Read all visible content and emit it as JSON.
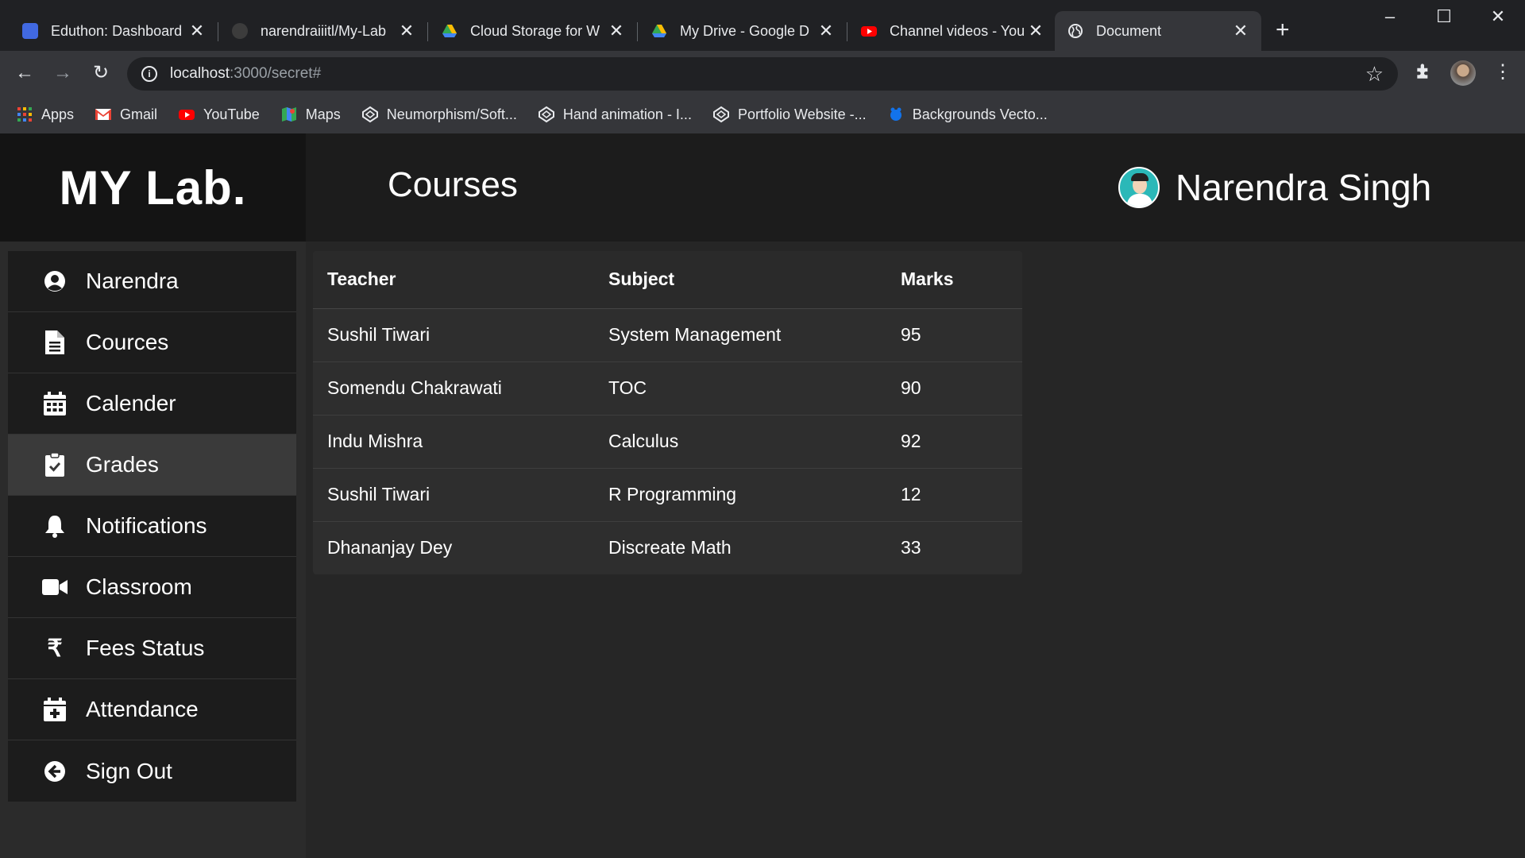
{
  "browser": {
    "tabs": [
      {
        "title": "Eduthon: Dashboard",
        "favicon_color": "#4169e1"
      },
      {
        "title": "narendraiiitl/My-Lab",
        "favicon_color": "#3c3c3c"
      },
      {
        "title": "Cloud Storage for W",
        "favicon_color": "#34a853"
      },
      {
        "title": "My Drive - Google D",
        "favicon_color": "#fbbc04"
      },
      {
        "title": "Channel videos - You",
        "favicon_color": "#ff0000"
      },
      {
        "title": "Document",
        "favicon_color": "#e8eaed"
      }
    ],
    "address": {
      "host": "localhost",
      "path": ":3000/secret#"
    },
    "bookmarks": [
      {
        "label": "Apps",
        "icon": "apps-grid-icon"
      },
      {
        "label": "Gmail",
        "icon": "gmail-icon"
      },
      {
        "label": "YouTube",
        "icon": "youtube-icon"
      },
      {
        "label": "Maps",
        "icon": "maps-icon"
      },
      {
        "label": "Neumorphism/Soft...",
        "icon": "codepen-icon"
      },
      {
        "label": "Hand animation - I...",
        "icon": "codepen-icon"
      },
      {
        "label": "Portfolio Website -...",
        "icon": "codepen-icon"
      },
      {
        "label": "Backgrounds Vecto...",
        "icon": "freepik-icon"
      }
    ]
  },
  "header": {
    "brand": "MY Lab.",
    "page_title": "Courses",
    "user_name": "Narendra Singh"
  },
  "sidebar": {
    "items": [
      {
        "label": "Narendra",
        "icon": "user-circle-icon"
      },
      {
        "label": "Cources",
        "icon": "file-icon"
      },
      {
        "label": "Calender",
        "icon": "calendar-icon"
      },
      {
        "label": "Grades",
        "icon": "clipboard-check-icon",
        "active": true
      },
      {
        "label": "Notifications",
        "icon": "bell-icon"
      },
      {
        "label": "Classroom",
        "icon": "video-camera-icon"
      },
      {
        "label": "Fees Status",
        "icon": "rupee-icon"
      },
      {
        "label": "Attendance",
        "icon": "calendar-plus-icon"
      },
      {
        "label": "Sign Out",
        "icon": "arrow-left-circle-icon"
      }
    ]
  },
  "grades": {
    "columns": [
      "Teacher",
      "Subject",
      "Marks"
    ],
    "rows": [
      {
        "teacher": "Sushil Tiwari",
        "subject": "System Management",
        "marks": "95"
      },
      {
        "teacher": "Somendu Chakrawati",
        "subject": "TOC",
        "marks": "90"
      },
      {
        "teacher": "Indu Mishra",
        "subject": "Calculus",
        "marks": "92"
      },
      {
        "teacher": "Sushil Tiwari",
        "subject": "R Programming",
        "marks": "12"
      },
      {
        "teacher": "Dhananjay Dey",
        "subject": "Discreate Math",
        "marks": "33"
      }
    ]
  },
  "colors": {
    "header_bg": "#1c1c1c",
    "brand_bg": "#141414",
    "sidebar_item_bg": "#1c1c1c",
    "sidebar_active_bg": "#3a3a3a",
    "content_bg": "#262626",
    "text": "#ffffff"
  }
}
